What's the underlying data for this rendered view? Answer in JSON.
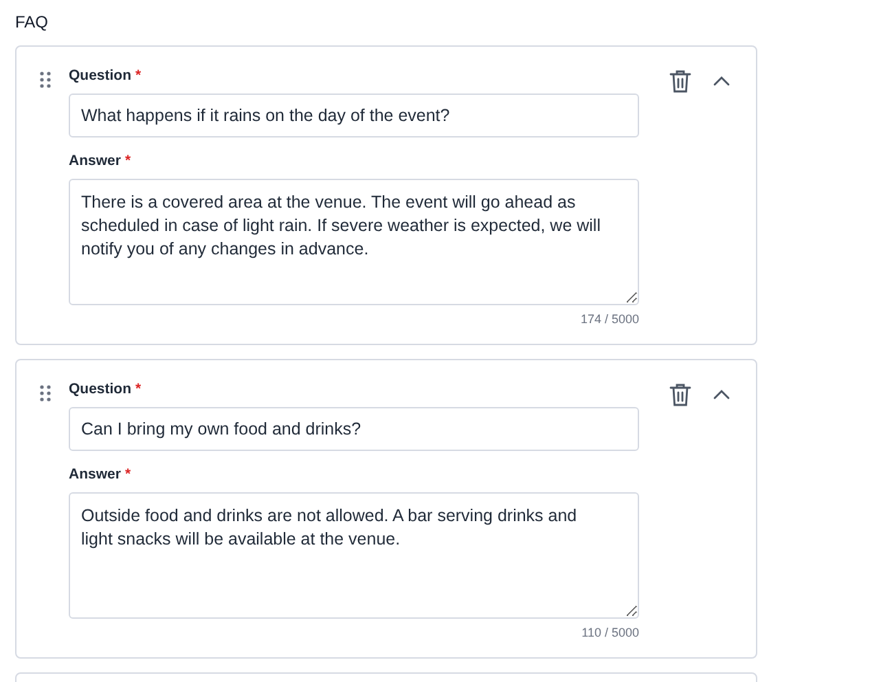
{
  "section_title": "FAQ",
  "items": [
    {
      "question_label": "Question",
      "question_required": "*",
      "question": "What happens if it rains on the day of the event?",
      "answer_label": "Answer",
      "answer_required": "*",
      "answer": "There is a covered area at the venue. The event will go ahead as scheduled in case of light rain. If severe weather is expected, we will notify you of any changes in advance.",
      "counter": "174 / 5000",
      "expanded": true
    },
    {
      "question_label": "Question",
      "question_required": "*",
      "question": "Can I bring my own food and drinks?",
      "answer_label": "Answer",
      "answer_required": "*",
      "answer": "Outside food and drinks are not allowed. A bar serving drinks and light snacks will be available at the venue.",
      "counter": "110 / 5000",
      "expanded": true
    }
  ]
}
